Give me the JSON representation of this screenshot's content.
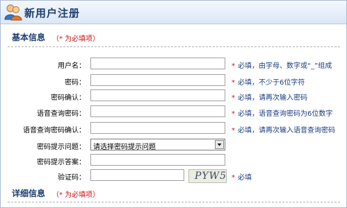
{
  "header": {
    "title": "新用户注册"
  },
  "basic": {
    "title": "基本信息",
    "note": "（* 为必填项）",
    "fields": [
      {
        "label": "用户名：",
        "hint": "必填，由字母、数字或“_”组成"
      },
      {
        "label": "密码：",
        "hint": "必填，不少于6位字符"
      },
      {
        "label": "密码确认：",
        "hint": "必填，请再次输入密码"
      },
      {
        "label": "语音查询密码：",
        "hint": "必填，语音查询密码为6位数字"
      },
      {
        "label": "语音查询密码确认：",
        "hint": "必填，请再次输入语音查询密码"
      },
      {
        "label": "密码提示问题：",
        "select_value": "请选择密码提示问题"
      },
      {
        "label": "密码提示答案："
      },
      {
        "label": "验证码：",
        "captcha": "PYW5",
        "hint": "必填"
      }
    ],
    "star": "*"
  },
  "detail": {
    "title": "详细信息",
    "note": "（* 为必填项）"
  }
}
